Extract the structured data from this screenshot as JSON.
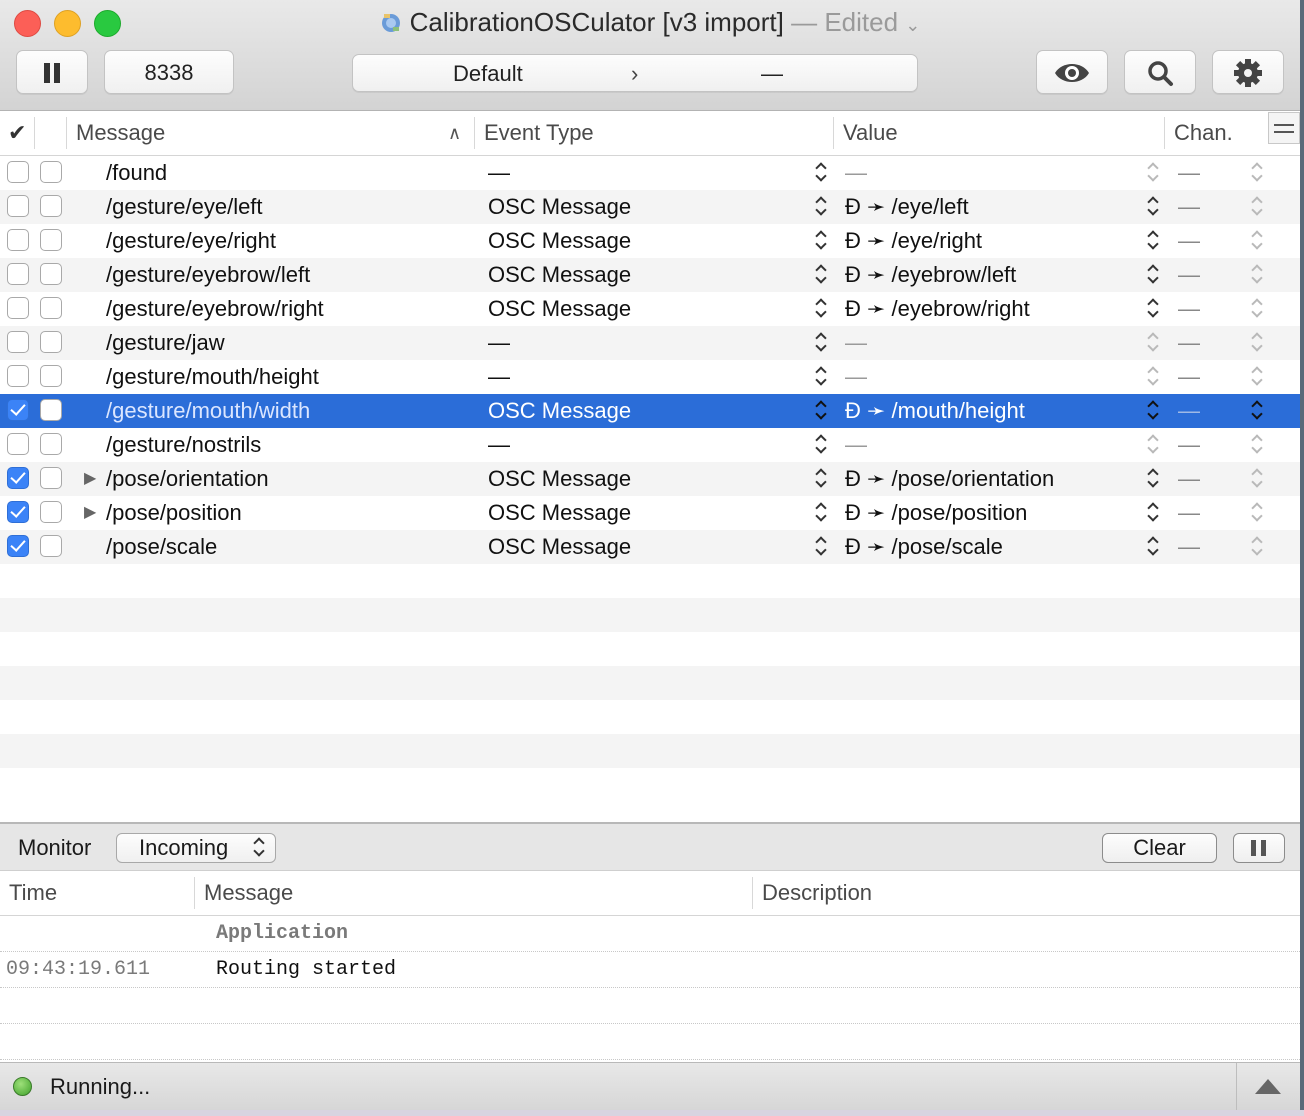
{
  "window": {
    "title": "CalibrationOSCulator [v3 import]",
    "edited": "— Edited",
    "colors": {
      "selection": "#2b6dd8",
      "checkbox_on": "#3b83f7",
      "close": "#fc5f57",
      "minimize": "#fdbc2e",
      "maximize": "#29c940",
      "status_led": "#3fa12a"
    }
  },
  "toolbar": {
    "port": "8338",
    "path_segment": "Default",
    "path_separator": "›",
    "path_value": "—",
    "icons": [
      "pause-icon",
      "eye-icon",
      "search-icon",
      "gear-icon"
    ]
  },
  "table": {
    "columns": {
      "check": "✔",
      "message": "Message",
      "event_type": "Event Type",
      "value": "Value",
      "channel": "Chan."
    },
    "rows": [
      {
        "enabled": false,
        "message": "/found",
        "event_type": "—",
        "value": "—",
        "channel": "",
        "expandable": false
      },
      {
        "enabled": false,
        "message": "/gesture/eye/left",
        "event_type": "OSC Message",
        "value": "Đ ➛ /eye/left",
        "channel": "—",
        "expandable": false
      },
      {
        "enabled": false,
        "message": "/gesture/eye/right",
        "event_type": "OSC Message",
        "value": "Đ ➛ /eye/right",
        "channel": "—",
        "expandable": false
      },
      {
        "enabled": false,
        "message": "/gesture/eyebrow/left",
        "event_type": "OSC Message",
        "value": "Đ ➛ /eyebrow/left",
        "channel": "—",
        "expandable": false
      },
      {
        "enabled": false,
        "message": "/gesture/eyebrow/right",
        "event_type": "OSC Message",
        "value": "Đ ➛ /eyebrow/right",
        "channel": "—",
        "expandable": false
      },
      {
        "enabled": false,
        "message": "/gesture/jaw",
        "event_type": "—",
        "value": "—",
        "channel": "—",
        "expandable": false
      },
      {
        "enabled": false,
        "message": "/gesture/mouth/height",
        "event_type": "—",
        "value": "—",
        "channel": "—",
        "expandable": false
      },
      {
        "enabled": true,
        "selected": true,
        "message": "/gesture/mouth/width",
        "event_type": "OSC Message",
        "value": "Đ ➛ /mouth/height",
        "channel": "—",
        "expandable": false
      },
      {
        "enabled": false,
        "message": "/gesture/nostrils",
        "event_type": "—",
        "value": "—",
        "channel": "—",
        "expandable": false
      },
      {
        "enabled": true,
        "message": "/pose/orientation",
        "event_type": "OSC Message",
        "value": "Đ ➛ /pose/orientation",
        "channel": "—",
        "expandable": true
      },
      {
        "enabled": true,
        "message": "/pose/position",
        "event_type": "OSC Message",
        "value": "Đ ➛ /pose/position",
        "channel": "—",
        "expandable": true
      },
      {
        "enabled": true,
        "message": "/pose/scale",
        "event_type": "OSC Message",
        "value": "Đ ➛ /pose/scale",
        "channel": "—",
        "expandable": false
      }
    ]
  },
  "monitor": {
    "label": "Monitor",
    "source": "Incoming",
    "clear_label": "Clear",
    "columns": {
      "time": "Time",
      "message": "Message",
      "description": "Description"
    },
    "category": "Application",
    "log": [
      {
        "time": "09:43:19.611",
        "message": "Routing started"
      }
    ]
  },
  "status": {
    "text": "Running..."
  }
}
